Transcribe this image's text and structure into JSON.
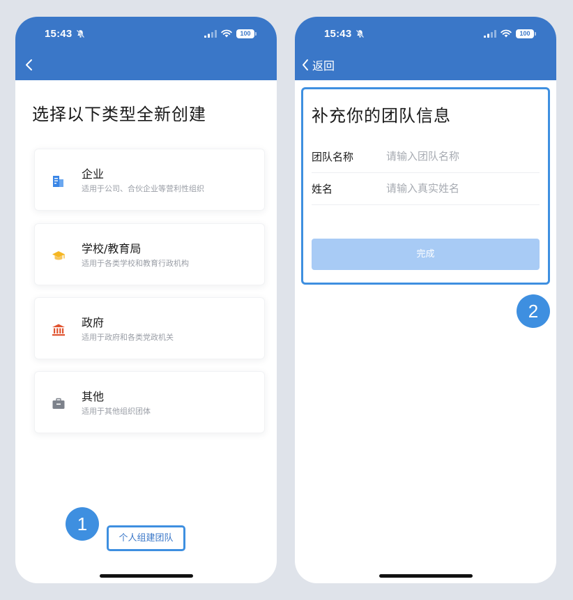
{
  "left_screen": {
    "status": {
      "time": "15:43",
      "battery": "100"
    },
    "title": "选择以下类型全新创建",
    "cards": [
      {
        "title": "企业",
        "desc": "适用于公司、合伙企业等营利性组织",
        "icon": "building-icon",
        "color": "#3a86e6"
      },
      {
        "title": "学校/教育局",
        "desc": "适用于各类学校和教育行政机构",
        "icon": "graduation-cap-icon",
        "color": "#f5b623"
      },
      {
        "title": "政府",
        "desc": "适用于政府和各类党政机关",
        "icon": "government-building-icon",
        "color": "#e0532f"
      },
      {
        "title": "其他",
        "desc": "适用于其他组织团体",
        "icon": "briefcase-icon",
        "color": "#7d828b"
      }
    ],
    "personal_button": "个人组建团队",
    "badge": "1"
  },
  "right_screen": {
    "status": {
      "time": "15:43",
      "battery": "100"
    },
    "back_label": "返回",
    "form": {
      "title": "补充你的团队信息",
      "fields": [
        {
          "label": "团队名称",
          "placeholder": "请输入团队名称"
        },
        {
          "label": "姓名",
          "placeholder": "请输入真实姓名"
        }
      ],
      "submit": "完成"
    },
    "badge": "2"
  },
  "colors": {
    "header": "#3a77c8",
    "highlight": "#3e8fe0",
    "submit_disabled": "#a8cbf5"
  }
}
